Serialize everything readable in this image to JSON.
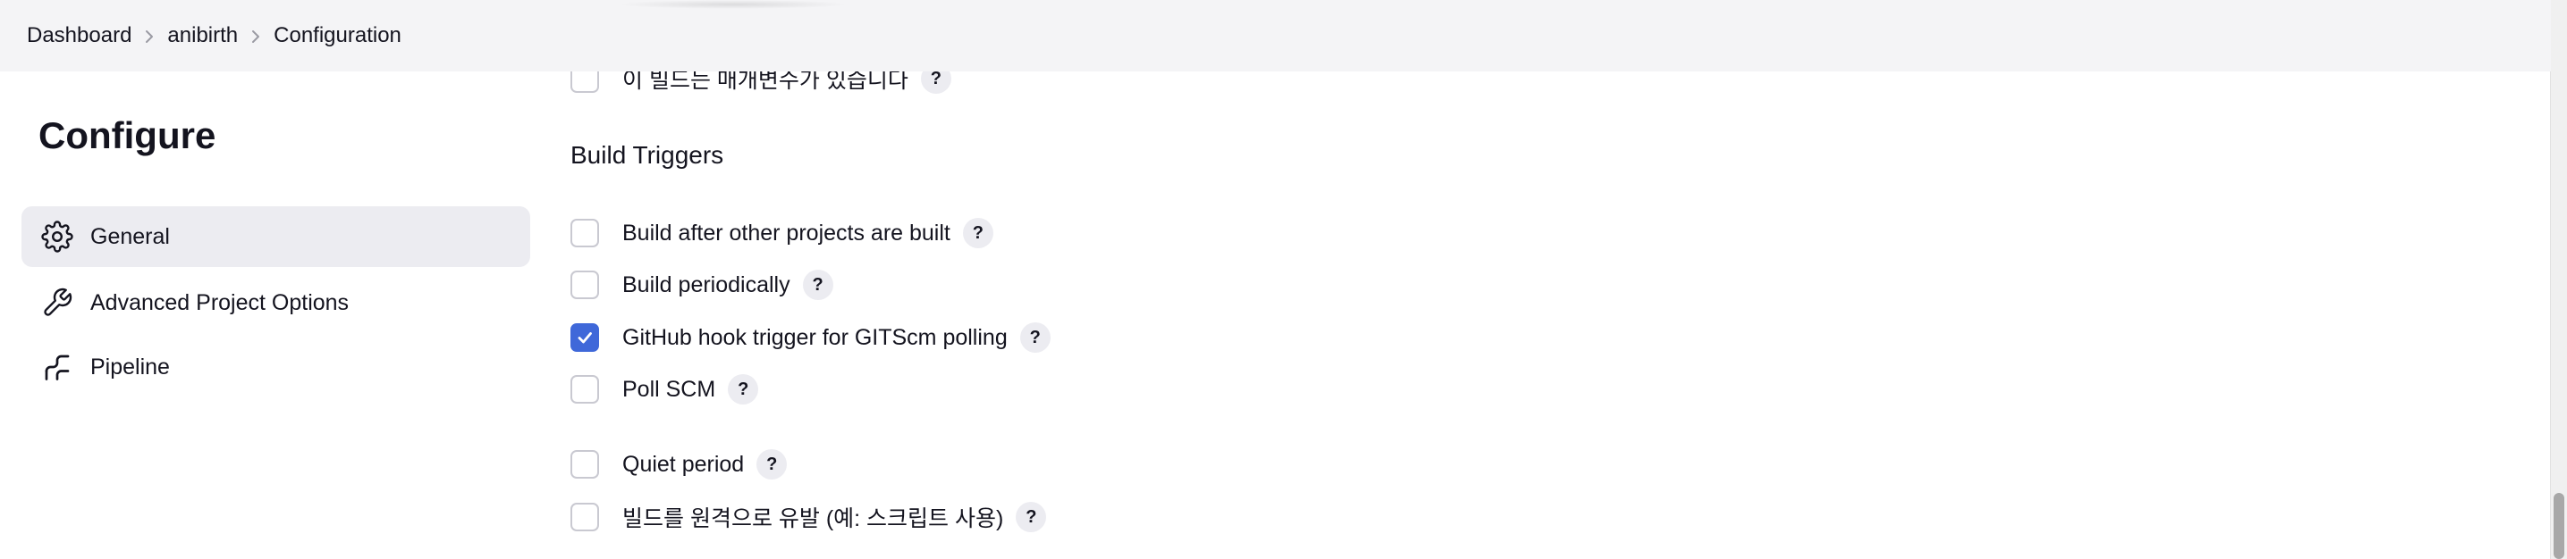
{
  "breadcrumb": {
    "items": [
      "Dashboard",
      "anibirth",
      "Configuration"
    ]
  },
  "sidebar": {
    "title": "Configure",
    "items": [
      {
        "label": "General",
        "icon": "gear-icon",
        "active": true
      },
      {
        "label": "Advanced Project Options",
        "icon": "wrench-icon",
        "active": false
      },
      {
        "label": "Pipeline",
        "icon": "pipeline-icon",
        "active": false
      }
    ]
  },
  "main": {
    "params_option": {
      "label": "이 빌드는 매개변수가 있습니다",
      "checked": false,
      "help": "?"
    },
    "build_triggers": {
      "title": "Build Triggers",
      "options": [
        {
          "label": "Build after other projects are built",
          "checked": false,
          "help": "?"
        },
        {
          "label": "Build periodically",
          "checked": false,
          "help": "?"
        },
        {
          "label": "GitHub hook trigger for GITScm polling",
          "checked": true,
          "help": "?"
        },
        {
          "label": "Poll SCM",
          "checked": false,
          "help": "?"
        },
        {
          "label": "Quiet period",
          "checked": false,
          "help": "?"
        },
        {
          "label": "빌드를 원격으로 유발 (예: 스크립트 사용)",
          "checked": false,
          "help": "?"
        }
      ]
    }
  },
  "colors": {
    "accent": "#3f68d9",
    "topbar_bg": "#f4f4f6",
    "active_item_bg": "#ececf1"
  }
}
